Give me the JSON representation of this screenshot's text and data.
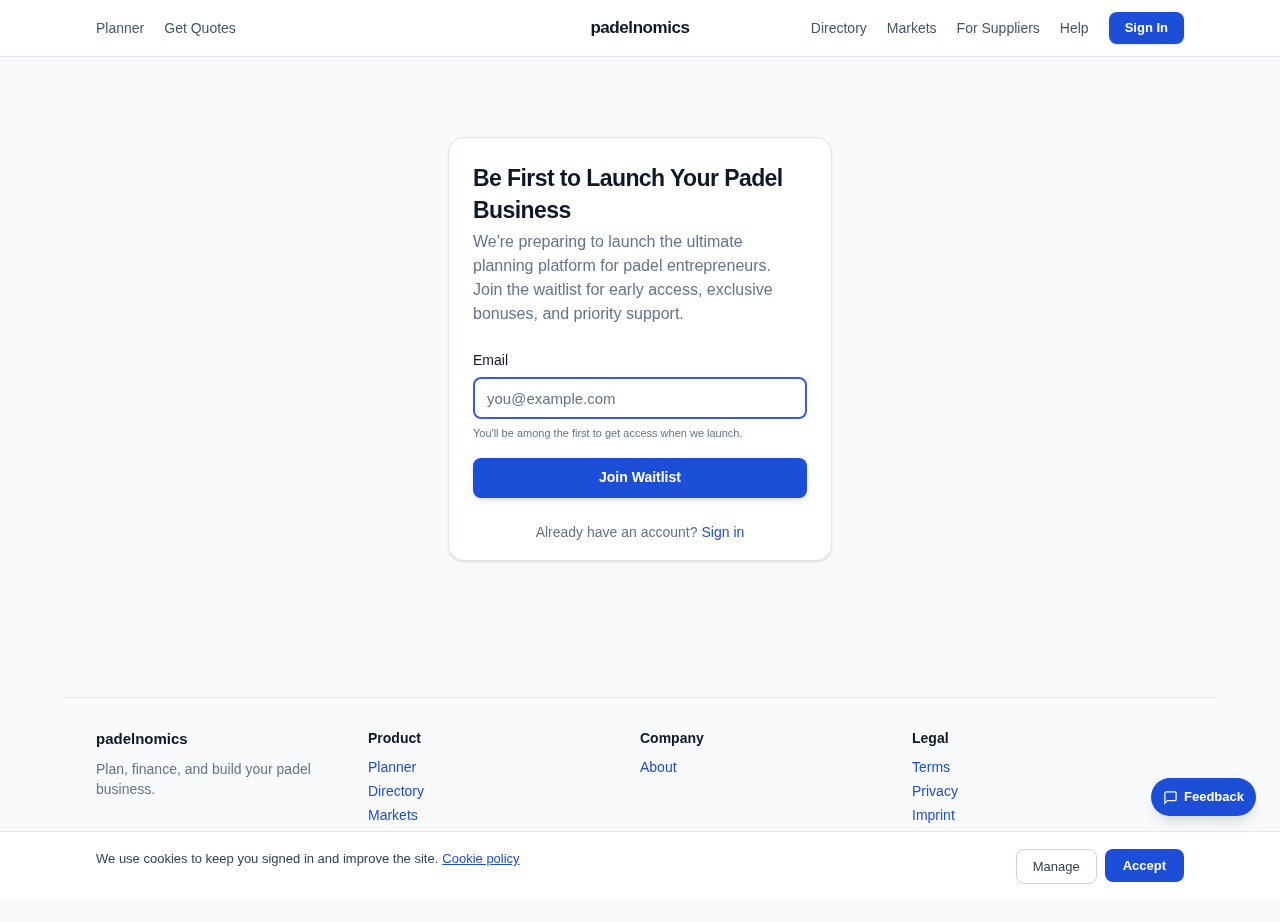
{
  "header": {
    "left_links": [
      "Planner",
      "Get Quotes"
    ],
    "logo": "padelnomics",
    "right_links": [
      "Directory",
      "Markets",
      "For Suppliers",
      "Help"
    ],
    "sign_in": "Sign In"
  },
  "card": {
    "title": "Be First to Launch Your Padel Business",
    "description": "We're preparing to launch the ultimate planning platform for padel entrepreneurs. Join the waitlist for early access, exclusive bonuses, and priority support.",
    "email_label": "Email",
    "email_placeholder": "you@example.com",
    "hint": "You'll be among the first to get access when we launch.",
    "submit": "Join Waitlist",
    "account_text": "Already have an account?",
    "account_link": "Sign in"
  },
  "footer": {
    "logo": "padelnomics",
    "tagline": "Plan, finance, and build your padel business.",
    "columns": [
      {
        "heading": "Product",
        "links": [
          "Planner",
          "Directory",
          "Markets"
        ]
      },
      {
        "heading": "Company",
        "links": [
          "About"
        ]
      },
      {
        "heading": "Legal",
        "links": [
          "Terms",
          "Privacy",
          "Imprint"
        ]
      }
    ]
  },
  "cookie_banner": {
    "text": "We use cookies to keep you signed in and improve the site.",
    "link": "Cookie policy",
    "manage": "Manage",
    "accept": "Accept"
  },
  "feedback": "Feedback"
}
